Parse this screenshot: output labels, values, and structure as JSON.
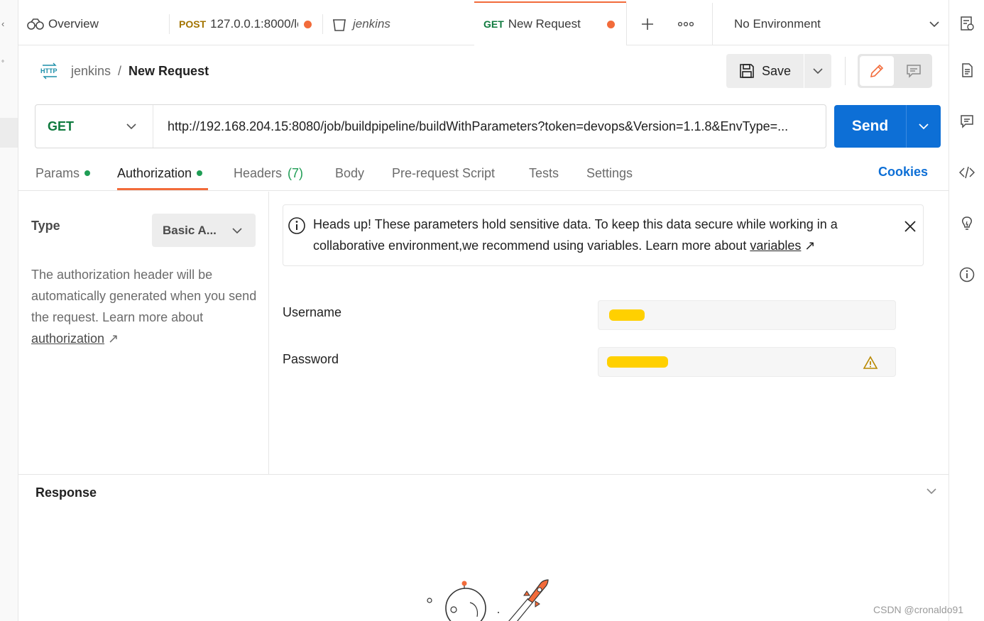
{
  "tabs": [
    {
      "method": "",
      "label": "Overview",
      "icon": "overview-icon"
    },
    {
      "method": "POST",
      "label": "127.0.0.1:8000/lo",
      "unsaved": true
    },
    {
      "method": "",
      "label": "jenkins",
      "icon": "collection-icon"
    },
    {
      "method": "GET",
      "label": "New Request",
      "unsaved": true,
      "active": true
    }
  ],
  "environment": {
    "label": "No Environment"
  },
  "breadcrumb": {
    "parent": "jenkins",
    "separator": "/",
    "current": "New Request"
  },
  "toolbar": {
    "save_label": "Save"
  },
  "request": {
    "method": "GET",
    "url": "http://192.168.204.15:8080/job/buildpipeline/buildWithParameters?token=devops&Version=1.1.8&EnvType=...",
    "send_label": "Send"
  },
  "request_tabs": [
    {
      "label": "Params",
      "dot": true
    },
    {
      "label": "Authorization",
      "dot": true,
      "active": true
    },
    {
      "label": "Headers",
      "count": "(7)"
    },
    {
      "label": "Body"
    },
    {
      "label": "Pre-request Script"
    },
    {
      "label": "Tests"
    },
    {
      "label": "Settings"
    }
  ],
  "cookies_label": "Cookies",
  "auth": {
    "type_label": "Type",
    "type_value": "Basic A...",
    "description": "The authorization header will be automatically generated when you send the request. Learn more about",
    "description_link": "authorization",
    "link_arrow": "↗"
  },
  "alert": {
    "text": "Heads up! These parameters hold sensitive data. To keep this data secure while working in a collaborative environment,we recommend using variables. Learn more about",
    "link": "variables",
    "link_arrow": "↗"
  },
  "fields": {
    "username_label": "Username",
    "password_label": "Password"
  },
  "response": {
    "title": "Response"
  },
  "watermark": "CSDN @cronaldo91",
  "colors": {
    "accent": "#f26b3a",
    "send_blue": "#0d6fd6",
    "get_green": "#0f7a3e",
    "post_gold": "#a37400",
    "mask_yellow": "#ffd000"
  }
}
